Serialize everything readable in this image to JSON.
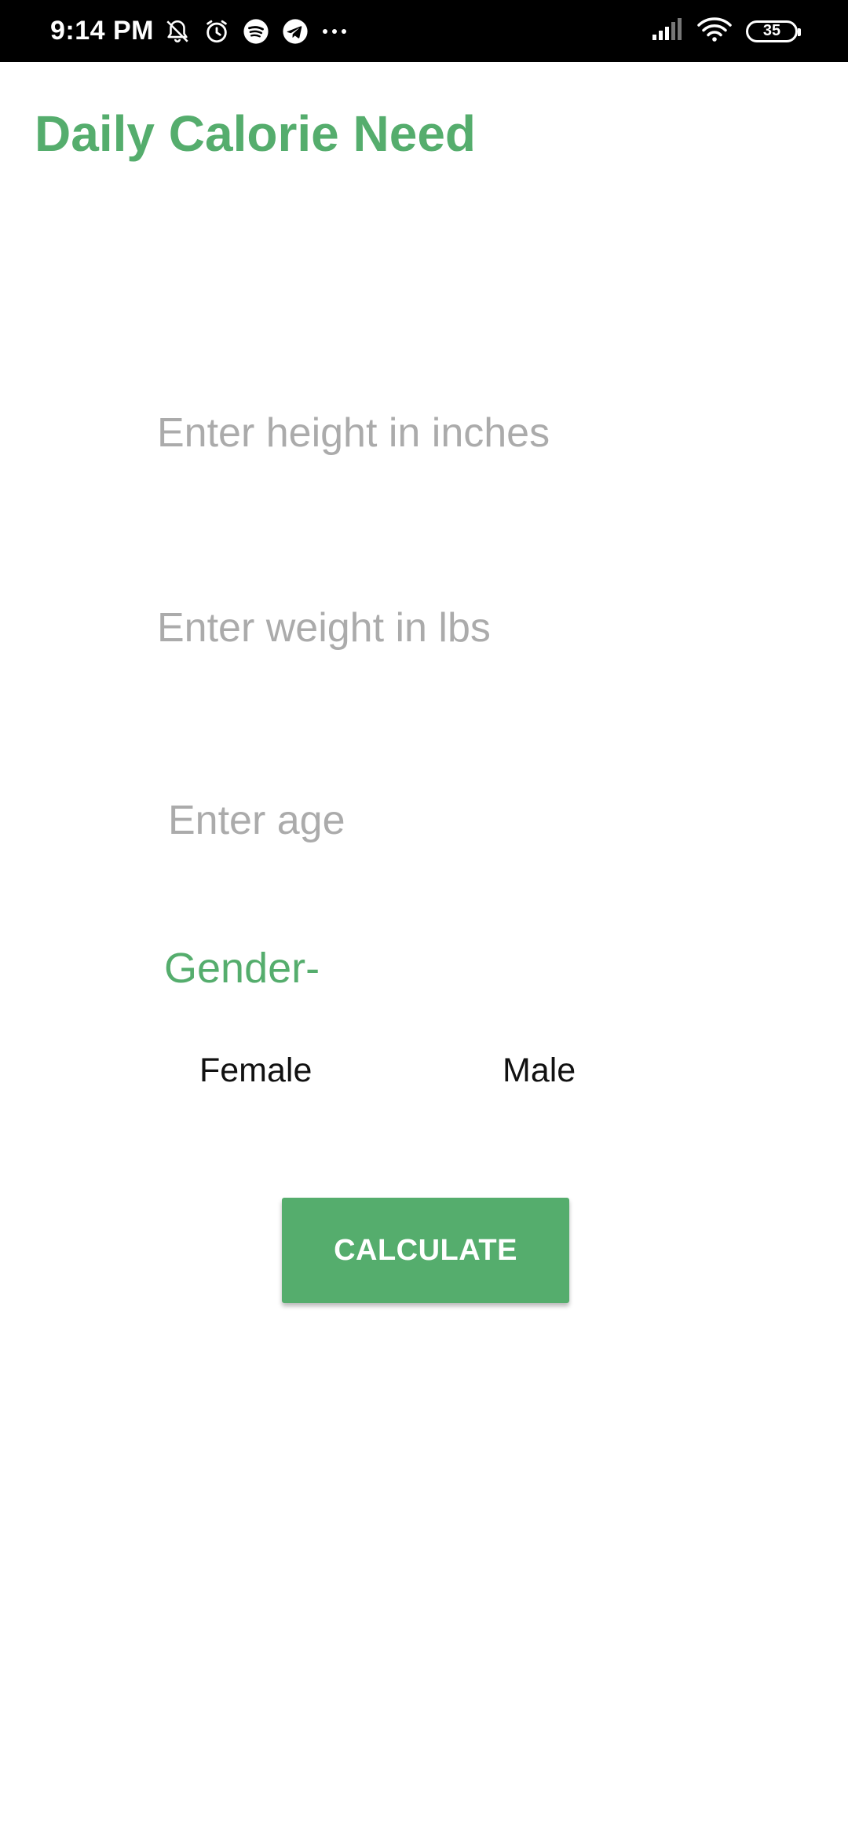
{
  "status_bar": {
    "time": "9:14 PM",
    "battery_level": "35",
    "icons_left": [
      "muted-bell-icon",
      "alarm-icon",
      "spotify-icon",
      "telegram-icon",
      "more-dots-icon"
    ],
    "icons_right": [
      "signal-icon",
      "wifi-icon",
      "battery-icon"
    ]
  },
  "app": {
    "title": "Daily Calorie Need",
    "accent_color": "#55ad6d"
  },
  "form": {
    "height_placeholder": "Enter height in inches",
    "height_value": "",
    "weight_placeholder": "Enter weight in lbs",
    "weight_value": "",
    "age_placeholder": "Enter age",
    "age_value": "",
    "gender_label": "Gender-",
    "gender_options": [
      "Female",
      "Male"
    ],
    "calculate_label": "CALCULATE"
  }
}
